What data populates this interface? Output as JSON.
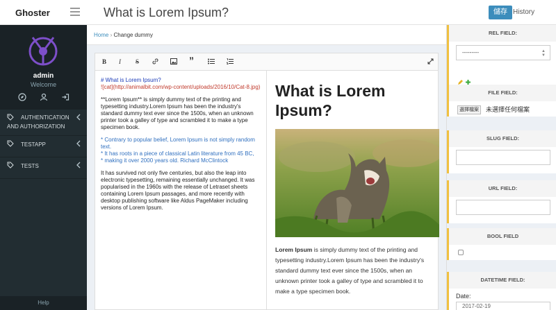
{
  "brand": {
    "name": "Ghoster"
  },
  "user": {
    "name": "admin",
    "subtitle": "Welcome"
  },
  "nav": {
    "auth_line1": "AUTHENTICATION",
    "auth_line2": "AND AUTHORIZATION",
    "testapp": "TESTAPP",
    "tests": "TESTS"
  },
  "help": "Help",
  "header": {
    "title": "What is Lorem Ipsum?",
    "save": "儲存",
    "history": "History"
  },
  "breadcrumb": {
    "home": "Home",
    "sep": "›",
    "current": "Change dummy"
  },
  "toolbar": {
    "bold": "B",
    "italic": "I",
    "strike": "S",
    "link": "🔗",
    "image": "▣",
    "quote": "”",
    "ul": "☰",
    "ol": "≡",
    "fullscreen": "⤢"
  },
  "markdown": {
    "heading": "# What is Lorem Ipsum?",
    "image_link": "![cat](http://animalbit.com/wp-content/uploads/2016/10/Cat-8.jpg)",
    "para1": "**Lorem Ipsum** is simply dummy text of the printing and typesetting industry.Lorem Ipsum has been the industry's standard dummy text ever since the 1500s, when an unknown printer took a galley of type and scrambled it to make a type specimen book.",
    "list1": "* Contrary to popular belief, Lorem Ipsum is not simply random text.",
    "list2": "* It has roots in a piece of classical Latin literature from 45 BC,",
    "list3": "* making it over 2000 years old. Richard McClintock",
    "para2": "It has survived not only five centuries, but also the leap into electronic typesetting, remaining essentially unchanged. It was popularised in the 1960s with the release of Letraset sheets containing Lorem Ipsum passages, and more recently with desktop publishing software like Aldus PageMaker including versions of Lorem Ipsum."
  },
  "preview": {
    "title": "What is Lorem Ipsum?",
    "bold": "Lorem Ipsum",
    "text": " is simply dummy text of the printing and typesetting industry.Lorem Ipsum has been the industry's standard dummy text ever since the 1500s, when an unknown printer took a galley of type and scrambled it to make a type specimen book."
  },
  "fields": {
    "rel": {
      "title": "REL FIELD:",
      "value": "---------"
    },
    "file": {
      "title": "FILE FIELD:",
      "button": "選擇檔案",
      "status": "未選擇任何檔案"
    },
    "slug": {
      "title": "SLUG FIELD:",
      "value": ""
    },
    "url": {
      "title": "URL FIELD:",
      "value": ""
    },
    "bool": {
      "title": "BOOL FIELD"
    },
    "datetime": {
      "title": "DATETIME FIELD:",
      "date_label": "Date:",
      "date_value": "2017-02-19"
    }
  },
  "colors": {
    "accent": "#3c8dbc",
    "sidebar": "#222d32",
    "field_marker": "#f0c040"
  }
}
